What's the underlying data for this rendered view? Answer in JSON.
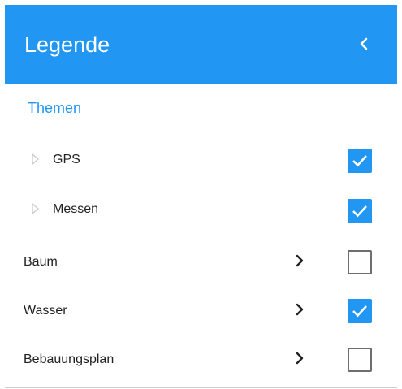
{
  "header": {
    "title": "Legende",
    "collapse_icon": "chevron-left-icon",
    "background": "#2196f3"
  },
  "section": {
    "title": "Themen"
  },
  "layers": [
    {
      "label": "GPS",
      "checked": true,
      "nested": true,
      "icon": "expand-triangle-icon"
    },
    {
      "label": "Messen",
      "checked": true,
      "nested": true,
      "icon": "expand-triangle-icon"
    },
    {
      "label": "Baum",
      "checked": false,
      "nested": false,
      "icon": "chevron-right-icon"
    },
    {
      "label": "Wasser",
      "checked": true,
      "nested": false,
      "icon": "chevron-right-icon"
    },
    {
      "label": "Bebauungsplan",
      "checked": false,
      "nested": false,
      "icon": "chevron-right-icon"
    }
  ],
  "colors": {
    "accent": "#2196f3",
    "text": "#212121",
    "unchecked_border": "#6e6e6e"
  }
}
